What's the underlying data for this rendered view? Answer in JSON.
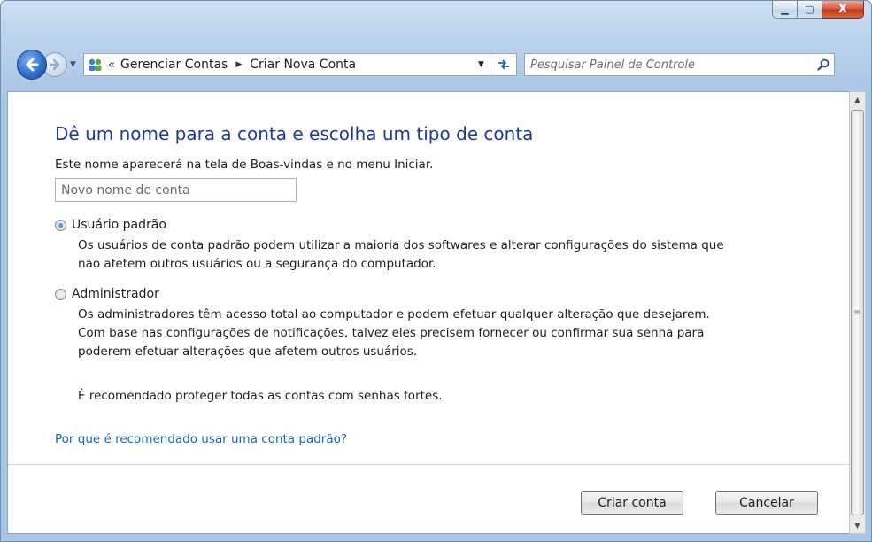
{
  "window": {
    "caption_buttons": {
      "minimize": "▁",
      "maximize": "▢",
      "close": "X"
    }
  },
  "nav": {
    "back_icon": "back-arrow-icon",
    "forward_icon": "forward-arrow-icon",
    "history_glyph": "▼",
    "breadcrumb_chevrons": "«",
    "breadcrumb": [
      "Gerenciar Contas",
      "Criar Nova Conta"
    ],
    "breadcrumb_separator": "▶",
    "dropdown_glyph": "▼",
    "refresh_glyph": "⇆"
  },
  "search": {
    "placeholder": "Pesquisar Painel de Controle"
  },
  "main": {
    "title": "Dê um nome para a conta e escolha um tipo de conta",
    "intro": "Este nome aparecerá na tela de Boas-vindas e no menu Iniciar.",
    "name_input_placeholder": "Novo nome de conta",
    "options": [
      {
        "label": "Usuário padrão",
        "checked": true,
        "description": [
          "Os usuários de conta padrão podem utilizar a maioria dos softwares e alterar configurações do sistema que",
          "não afetem outros usuários ou a segurança do computador."
        ]
      },
      {
        "label": "Administrador",
        "checked": false,
        "description": [
          "Os administradores têm acesso total ao computador e podem efetuar qualquer alteração que desejarem.",
          "Com base nas configurações de notificações, talvez eles precisem fornecer ou confirmar sua senha para",
          "poderem efetuar alterações que afetem outros usuários."
        ]
      }
    ],
    "recommendation": "É recomendado proteger todas as contas com senhas fortes.",
    "help_link": "Por que é recomendado usar uma conta padrão?"
  },
  "footer": {
    "create_label": "Criar conta",
    "cancel_label": "Cancelar"
  },
  "colors": {
    "title": "#1e3c96",
    "link": "#1c64b6",
    "close_button": "#c0361c"
  }
}
